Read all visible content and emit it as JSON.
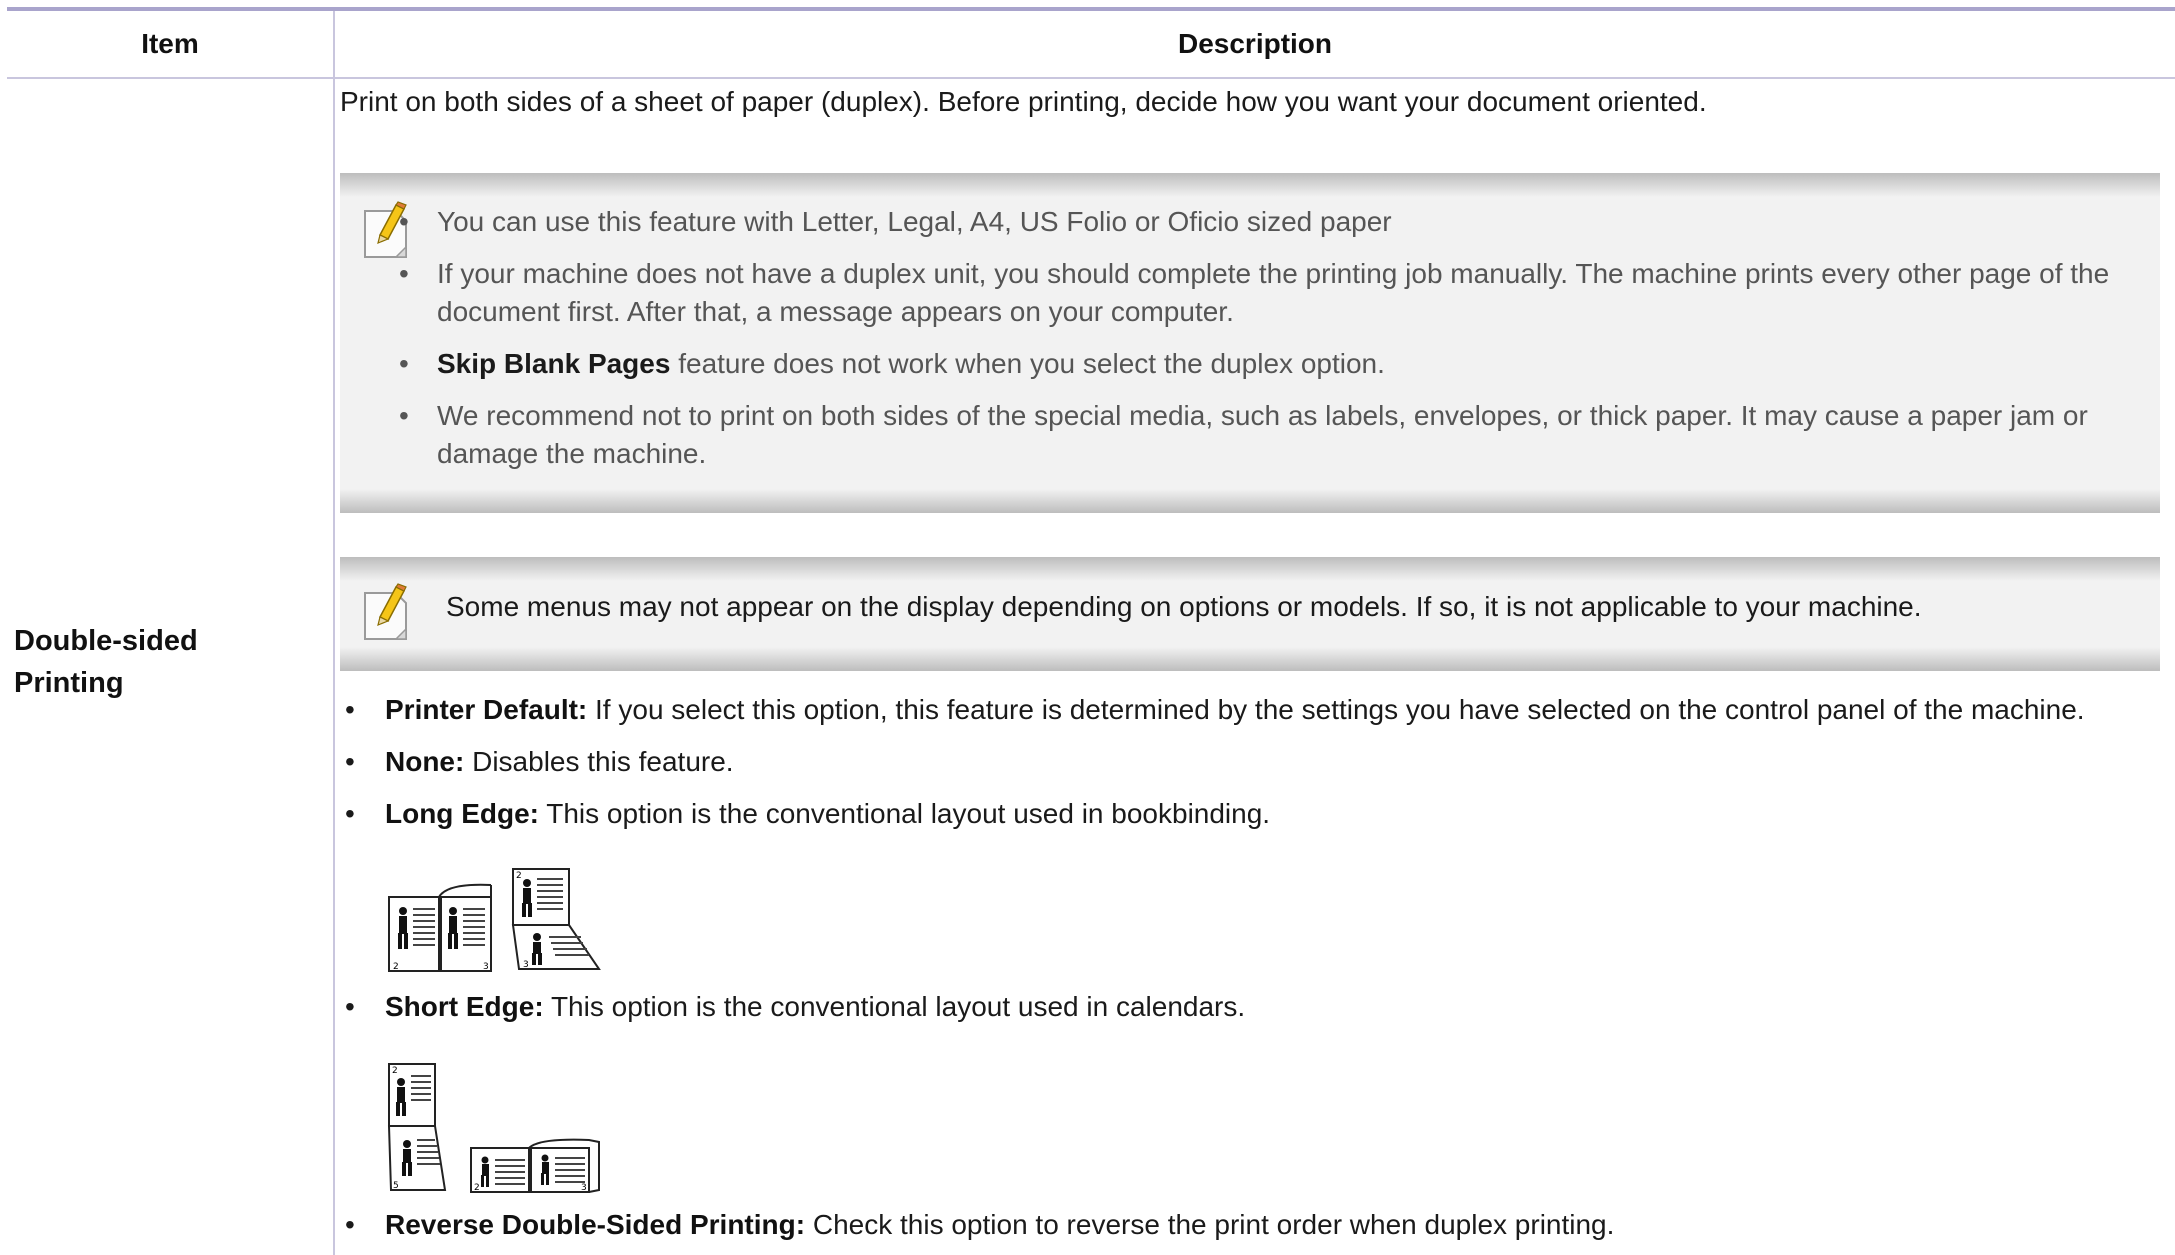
{
  "table": {
    "header": {
      "item": "Item",
      "description": "Description"
    }
  },
  "row": {
    "item_label_line1": "Double-sided",
    "item_label_line2": "Printing",
    "intro": "Print on both sides of a sheet of paper (duplex). Before printing, decide how you want your document oriented.",
    "note1": {
      "icon": "note-pencil-icon",
      "bullets": [
        {
          "bold": "",
          "text": "You can use this feature with Letter, Legal, A4, US Folio or Oficio sized paper"
        },
        {
          "bold": "",
          "text": "If your machine does not have a duplex unit, you should complete the printing job manually. The machine prints every other page of the document first. After that, a message appears on your computer."
        },
        {
          "bold": "Skip Blank Pages",
          "text": " feature does not work when you select the duplex option."
        },
        {
          "bold": "",
          "text": "We recommend not to print on both sides of the special media, such as labels, envelopes, or thick paper. It may cause a paper jam or damage the machine."
        }
      ]
    },
    "note2": {
      "icon": "note-pencil-icon",
      "text": "Some menus may not appear on the display depending on options or models. If so, it is not applicable to your machine."
    },
    "options": [
      {
        "bold": "Printer Default:",
        "text": " If you select this option, this feature is determined by the settings you have selected on the control panel of the machine."
      },
      {
        "bold": "None:",
        "text": " Disables this feature."
      },
      {
        "bold": "Long Edge:",
        "text": " This option is the conventional layout used in bookbinding."
      },
      {
        "bold": "Short Edge:",
        "text": " This option is the conventional layout used in calendars."
      },
      {
        "bold": "Reverse Double-Sided Printing:",
        "text": " Check this option to reverse the print order when duplex printing."
      }
    ],
    "illustration_page_numbers": {
      "two": "2",
      "three": "3",
      "five": "5"
    }
  },
  "colors": {
    "header_rule": "#a9a4cc",
    "grid_line": "#c9c6de",
    "note_bg": "#f2f2f2"
  }
}
